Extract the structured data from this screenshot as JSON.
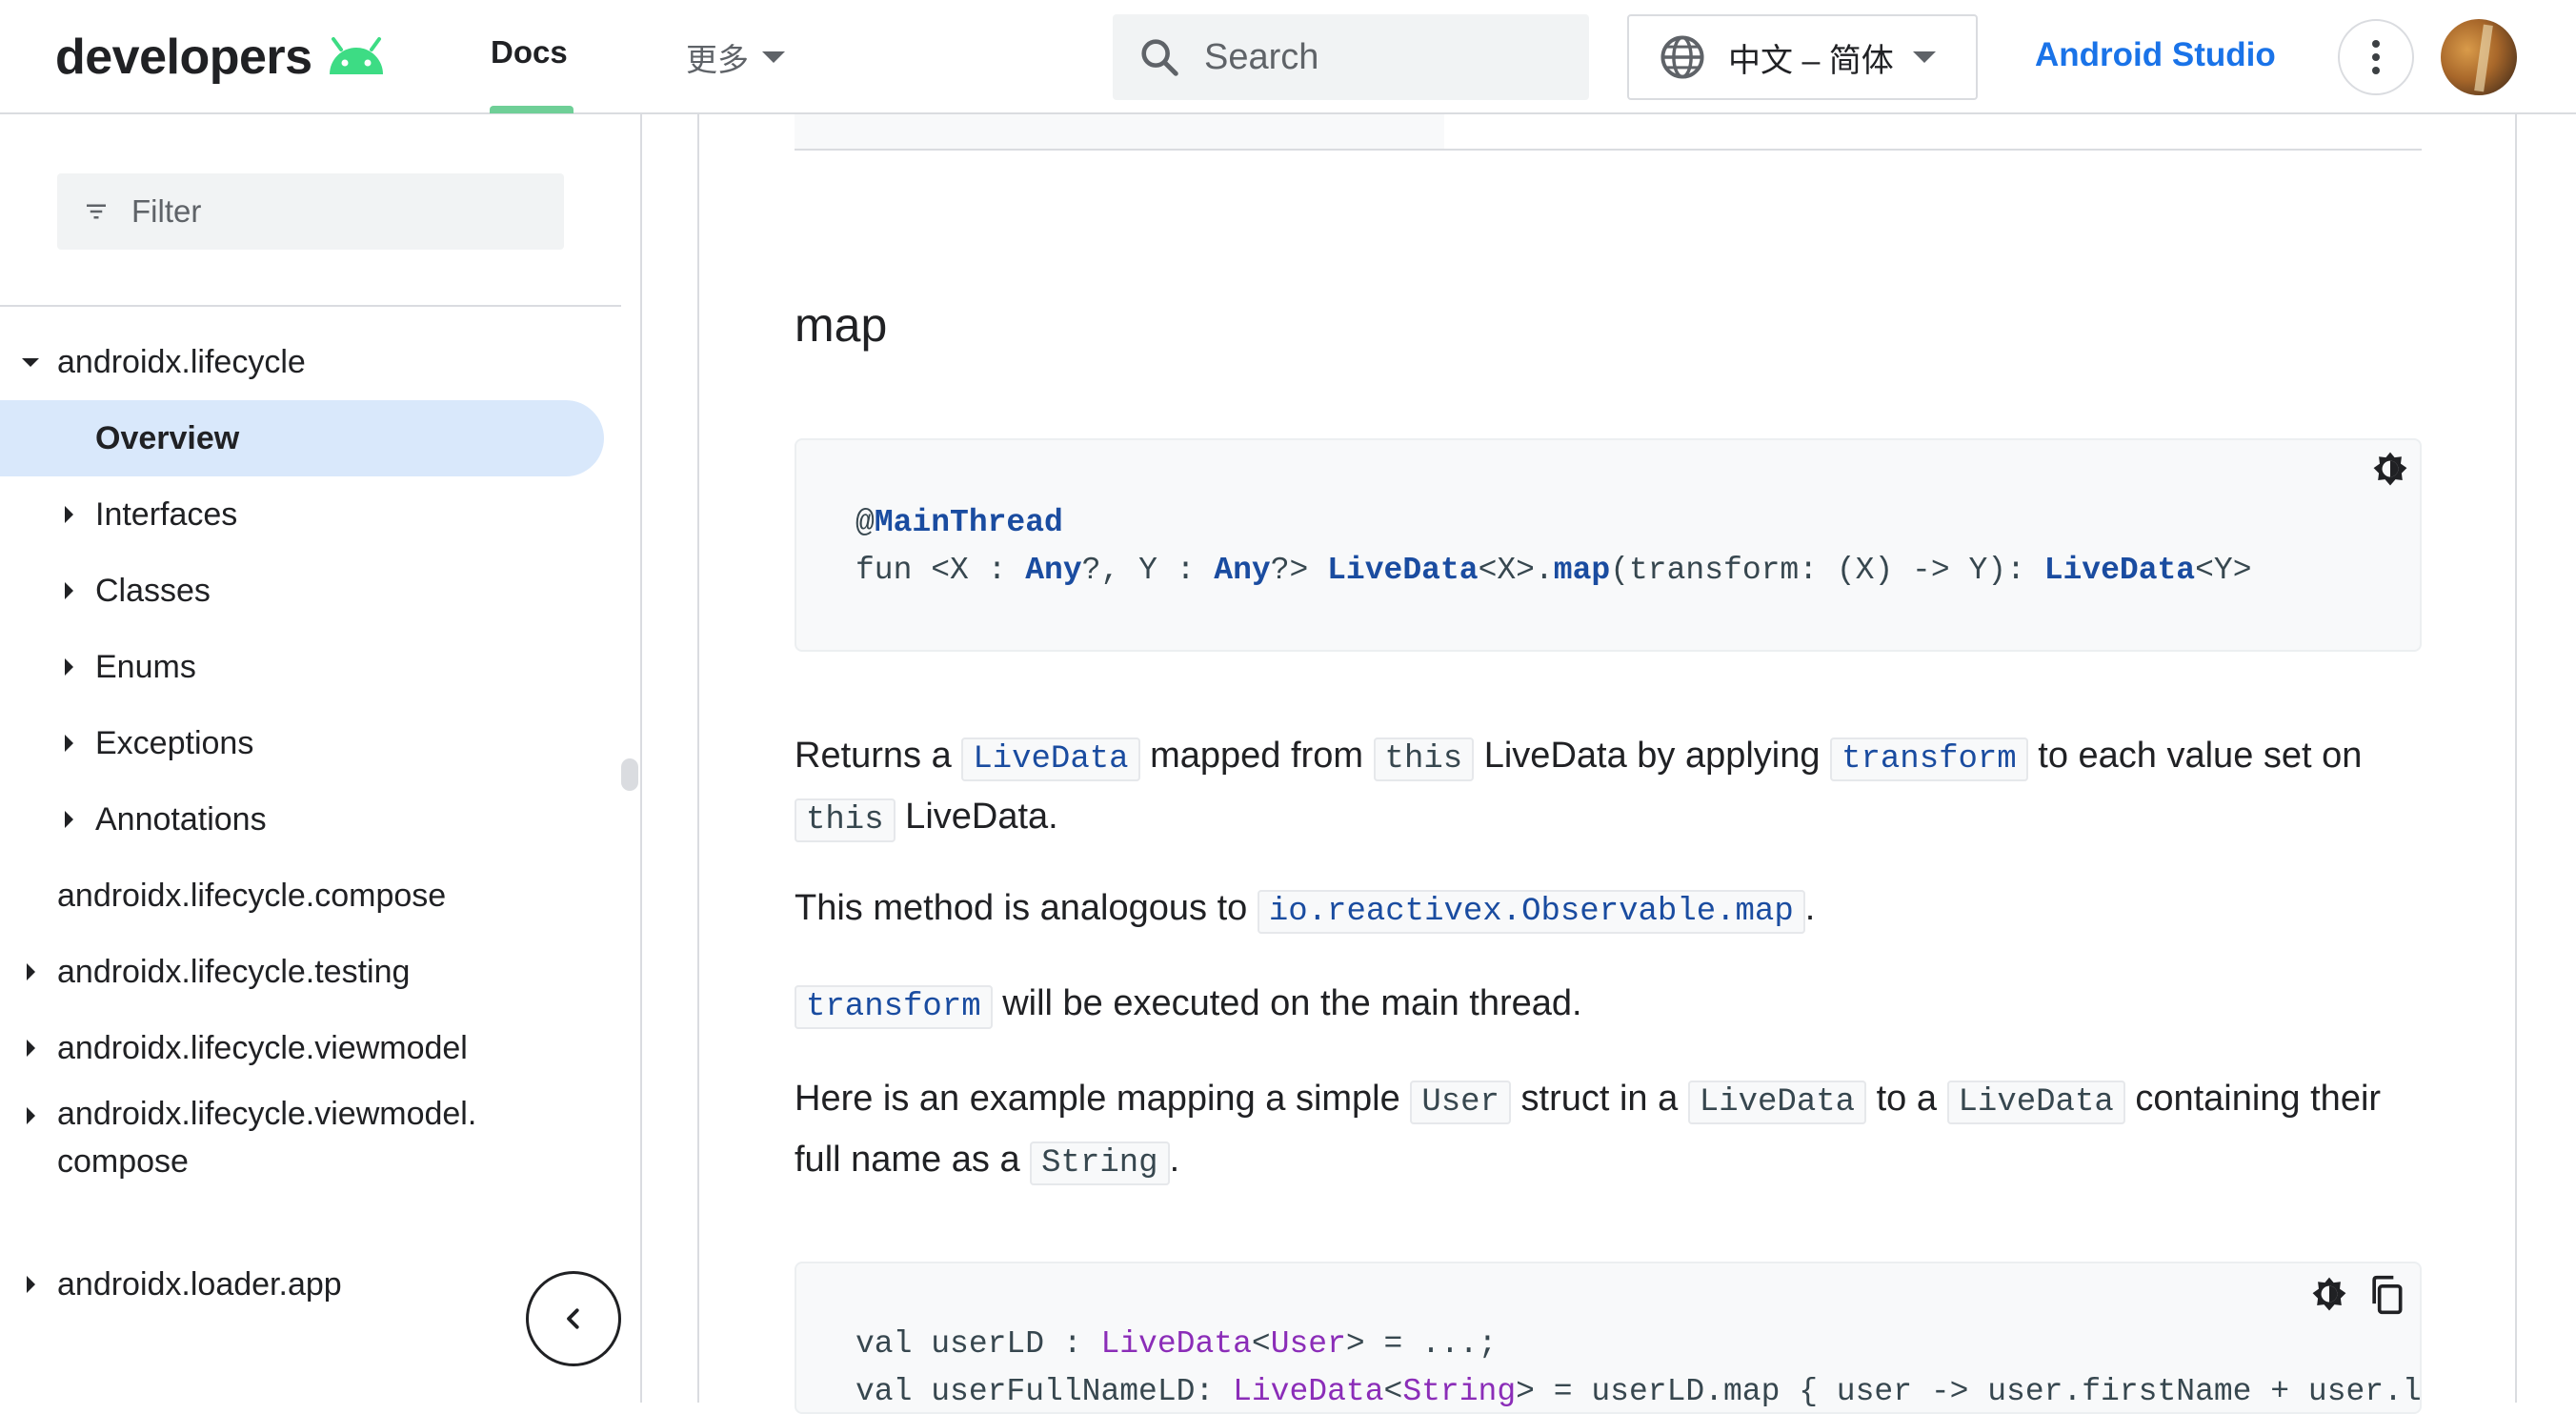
{
  "header": {
    "logo_text": "developers",
    "nav_docs": "Docs",
    "nav_more": "更多",
    "search_placeholder": "Search",
    "language": "中文 – 简体",
    "studio_link": "Android Studio",
    "accent_color": "#1a73e8",
    "active_tab_color": "#6fcf97"
  },
  "sidebar": {
    "filter_placeholder": "Filter",
    "items": [
      {
        "label": "androidx.lifecycle",
        "state": "expanded"
      },
      {
        "label": "Overview",
        "state": "active"
      },
      {
        "label": "Interfaces",
        "state": "collapsed"
      },
      {
        "label": "Classes",
        "state": "collapsed"
      },
      {
        "label": "Enums",
        "state": "collapsed"
      },
      {
        "label": "Exceptions",
        "state": "collapsed"
      },
      {
        "label": "Annotations",
        "state": "collapsed"
      },
      {
        "label": "androidx.lifecycle.compose",
        "state": "leaf"
      },
      {
        "label": "androidx.lifecycle.testing",
        "state": "collapsed"
      },
      {
        "label": "androidx.lifecycle.viewmodel",
        "state": "collapsed"
      },
      {
        "label": "androidx.lifecycle.viewmodel.",
        "label2": "compose",
        "state": "collapsed"
      },
      {
        "label": "androidx.loader.app",
        "state": "collapsed"
      }
    ]
  },
  "main": {
    "heading": "map",
    "signature": {
      "annotation_at": "@",
      "annotation": "MainThread",
      "t1": "fun <X : ",
      "any1": "Any",
      "t2": "?, Y : ",
      "any2": "Any",
      "t3": "?> ",
      "ld1": "LiveData",
      "t4": "<X>.",
      "map": "map",
      "t5": "(transform: (X) -> Y): ",
      "ld2": "LiveData",
      "t6": "<Y>"
    },
    "p1": {
      "a": "Returns a ",
      "c1": "LiveData",
      "b": " mapped from ",
      "c2": "this",
      "c": " LiveData by applying ",
      "c3": "transform",
      "d": " to each value set on ",
      "c4": "this",
      "e": " LiveData."
    },
    "p2": {
      "a": "This method is analogous to ",
      "c1": "io.reactivex.Observable.map",
      "b": "."
    },
    "p3": {
      "c1": "transform",
      "a": " will be executed on the main thread."
    },
    "p4": {
      "a": "Here is an example mapping a simple ",
      "c1": "User",
      "b": " struct in a ",
      "c2": "LiveData",
      "c": " to a ",
      "c3": "LiveData",
      "d": " containing their full name as a ",
      "c4": "String",
      "e": "."
    },
    "example": {
      "l1a": "val userLD : ",
      "l1b": "LiveData",
      "l1c": "<",
      "l1d": "User",
      "l1e": "> = ...;",
      "l2a": "val userFullNameLD: ",
      "l2b": "LiveData",
      "l2c": "<",
      "l2d": "String",
      "l2e": "> = userLD.map { user -> user.firstName + user.lastName }"
    }
  }
}
